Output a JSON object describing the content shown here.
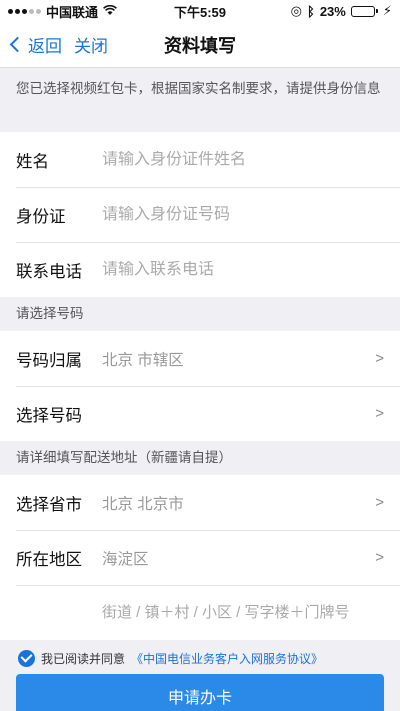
{
  "status_bar": {
    "carrier": "中国联通",
    "time": "下午5:59",
    "battery": "23%",
    "battery_level": 0.23
  },
  "nav": {
    "back_label": "返回",
    "close_label": "关闭",
    "title": "资料填写"
  },
  "notice": "您已选择视频红包卡，根据国家实名制要求，请提供身份信息",
  "identity": {
    "name_label": "姓名",
    "name_placeholder": "请输入身份证件姓名",
    "id_label": "身份证",
    "id_placeholder": "请输入身份证号码",
    "phone_label": "联系电话",
    "phone_placeholder": "请输入联系电话"
  },
  "number_section": {
    "header": "请选择号码",
    "location_label": "号码归属",
    "location_value": "北京 市辖区",
    "select_label": "选择号码",
    "select_value": "",
    "arrow": ">"
  },
  "address_section": {
    "header": "请详细填写配送地址（新疆请自提）",
    "province_label": "选择省市",
    "province_value": "北京 北京市",
    "district_label": "所在地区",
    "district_value": "海淀区",
    "street_placeholder": "街道 / 镇＋村 / 小区 / 写字楼＋门牌号"
  },
  "agreement": {
    "text": "我已阅读并同意",
    "link": "《中国电信业务客户入网服务协议》"
  },
  "submit_label": "申请办卡"
}
